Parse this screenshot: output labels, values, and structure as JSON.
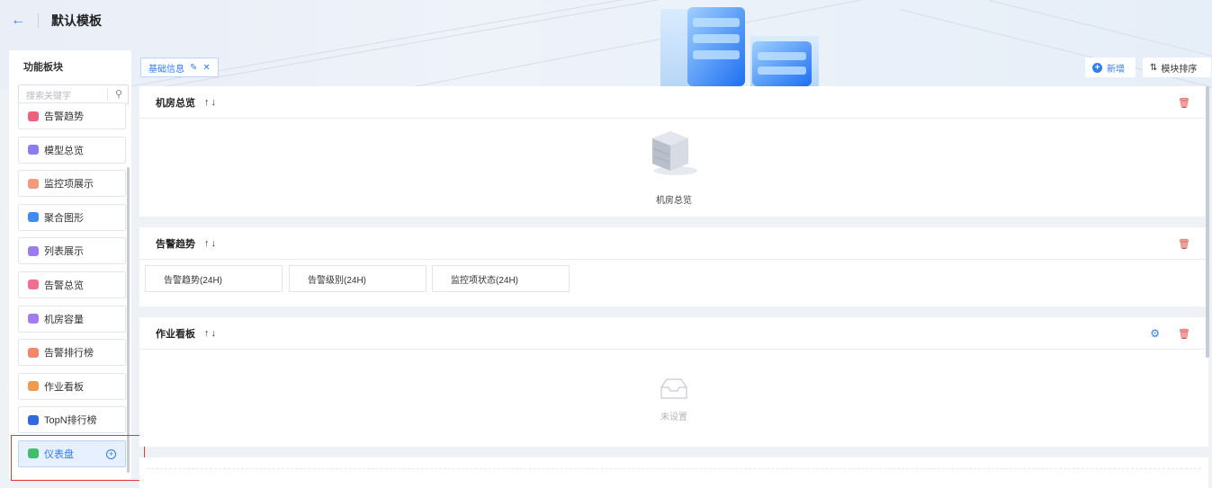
{
  "header": {
    "back_icon": "arrow-left-icon",
    "title": "默认模板"
  },
  "left_panel": {
    "title": "功能板块",
    "search_placeholder": "搜索关键字",
    "modules": [
      {
        "label": "告警趋势",
        "color": "#f0607a"
      },
      {
        "label": "模型总览",
        "color": "#8a7cf2"
      },
      {
        "label": "监控项展示",
        "color": "#f49a7a"
      },
      {
        "label": "聚合图形",
        "color": "#3b8cf5"
      },
      {
        "label": "列表展示",
        "color": "#9b7cf0"
      },
      {
        "label": "告警总览",
        "color": "#f26d8f"
      },
      {
        "label": "机房容量",
        "color": "#a27cf3"
      },
      {
        "label": "告警排行榜",
        "color": "#f4866a"
      },
      {
        "label": "作业看板",
        "color": "#f09a4a"
      },
      {
        "label": "TopN排行榜",
        "color": "#2f6bdf"
      },
      {
        "label": "仪表盘",
        "color": "#3fbf6a"
      }
    ]
  },
  "tabs": {
    "base_info": "基础信息",
    "edit_icon": "pencil-icon",
    "close_icon": "close-icon"
  },
  "toolbar": {
    "add_label": "新增",
    "sort_label": "模块排序"
  },
  "cards": [
    {
      "title": "机房总览",
      "arrows": "↑↓",
      "caption": "机房总览"
    },
    {
      "title": "告警趋势",
      "arrows": "↑↓",
      "tiles": [
        "告警趋势(24H)",
        "告警级别(24H)",
        "监控项状态(24H)"
      ]
    },
    {
      "title": "作业看板",
      "arrows": "↑↓",
      "caption": "未设置"
    }
  ],
  "colors": {
    "accent": "#2f7cf6",
    "danger": "#e0433d"
  }
}
